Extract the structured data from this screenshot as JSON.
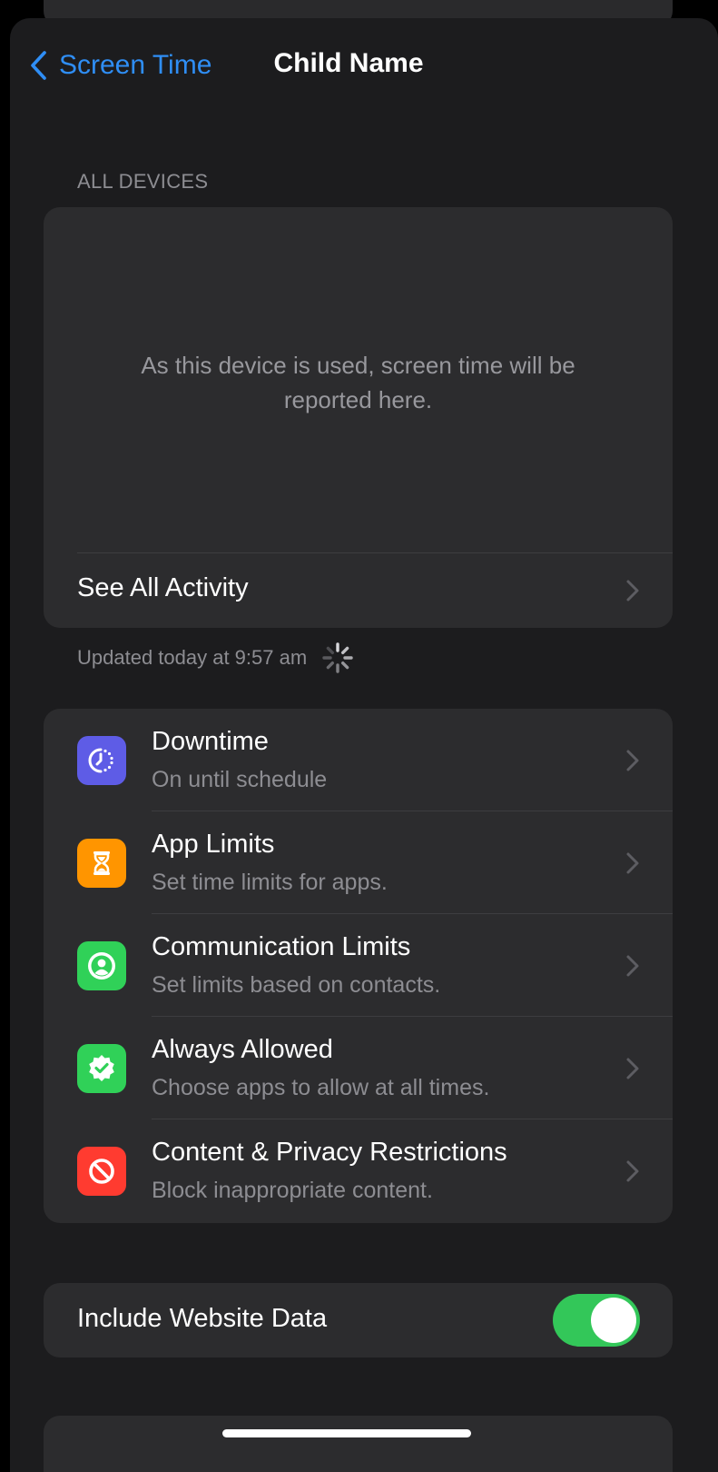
{
  "nav": {
    "back_label": "Screen Time",
    "title": "Child Name"
  },
  "all_devices": {
    "header": "ALL DEVICES",
    "message": "As this device is used, screen time will be reported here.",
    "see_all_label": "See All Activity",
    "updated_text": "Updated today at 9:57 am"
  },
  "settings": {
    "items": [
      {
        "title": "Downtime",
        "subtitle": "On until schedule",
        "icon": "downtime-icon",
        "color": "#5e5ce6"
      },
      {
        "title": "App Limits",
        "subtitle": "Set time limits for apps.",
        "icon": "hourglass-icon",
        "color": "#ff9500"
      },
      {
        "title": "Communication Limits",
        "subtitle": "Set limits based on contacts.",
        "icon": "person-circle-icon",
        "color": "#30d158"
      },
      {
        "title": "Always Allowed",
        "subtitle": "Choose apps to allow at all times.",
        "icon": "checkmark-seal-icon",
        "color": "#30d158"
      },
      {
        "title": "Content & Privacy Restrictions",
        "subtitle": "Block inappropriate content.",
        "icon": "no-entry-icon",
        "color": "#ff3b30"
      }
    ]
  },
  "website_data": {
    "label": "Include Website Data",
    "enabled": true,
    "color": "#33c759"
  },
  "colors": {
    "accent": "#2f8ef5",
    "background": "#1c1c1e",
    "card": "#2c2c2e"
  }
}
